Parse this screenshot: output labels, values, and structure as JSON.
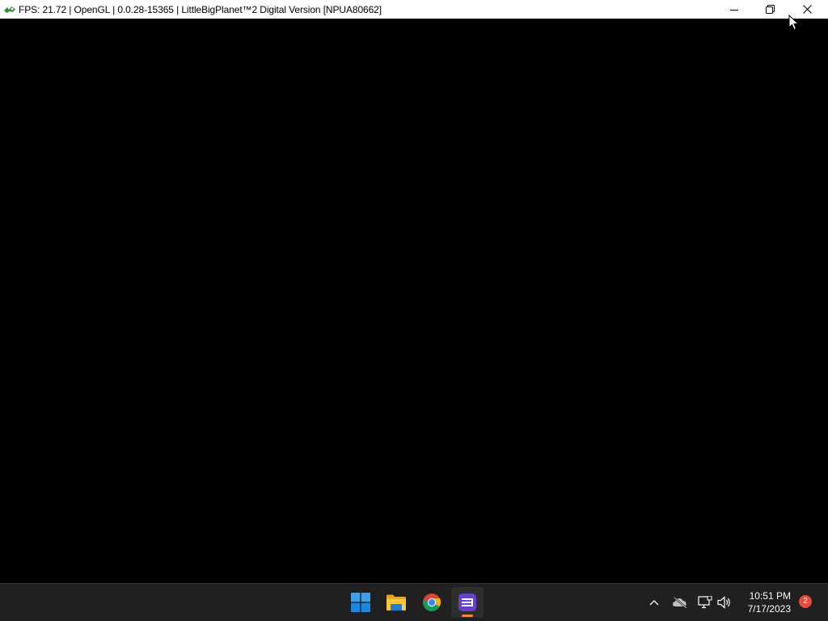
{
  "window": {
    "title": "FPS: 21.72 | OpenGL | 0.0.28-15365 | LittleBigPlanet™2 Digital Version [NPUA80662]",
    "icon": "rpcs3-app-icon",
    "controls": {
      "minimize_icon": "minimize-icon",
      "restore_icon": "restore-icon",
      "close_icon": "close-icon"
    }
  },
  "taskbar": {
    "apps": [
      {
        "name": "Start",
        "icon": "windows-start-icon"
      },
      {
        "name": "File Explorer",
        "icon": "folder-icon"
      },
      {
        "name": "Google Chrome",
        "icon": "chrome-icon"
      },
      {
        "name": "RPCS3",
        "icon": "app-list-icon",
        "active": true
      }
    ],
    "tray": {
      "chevron_icon": "chevron-up-icon",
      "onedrive_icon": "cloud-off-icon",
      "network_icon": "network-icon",
      "volume_icon": "speaker-icon"
    },
    "clock": {
      "time": "10:51 PM",
      "date": "7/17/2023"
    },
    "notifications": {
      "count": "2"
    }
  },
  "colors": {
    "taskbar_bg": "#202020",
    "content_bg": "#000000",
    "accent_indicator": "#f08a3c",
    "badge": "#e84a3c"
  }
}
